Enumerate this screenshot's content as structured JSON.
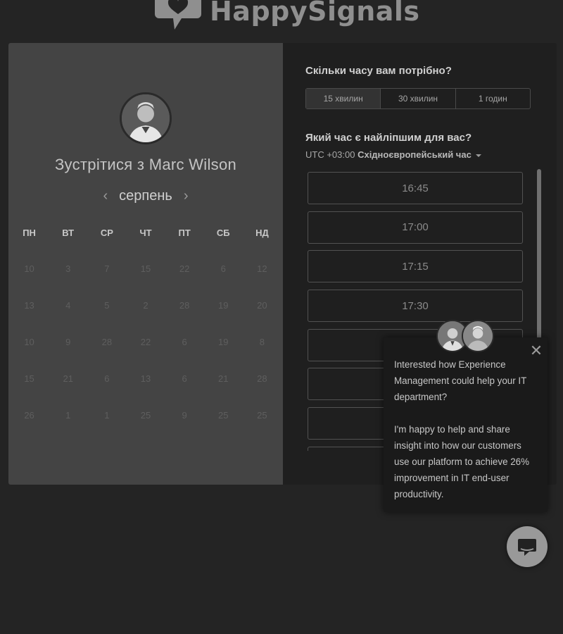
{
  "brand": {
    "logo_text": "HappySignals"
  },
  "calendar_panel": {
    "meet_title": "Зустрітися з Marc Wilson",
    "month": "серпень",
    "weekdays": [
      "ПН",
      "ВТ",
      "СР",
      "ЧТ",
      "ПТ",
      "СБ",
      "НД"
    ],
    "days": [
      "10",
      "3",
      "7",
      "15",
      "22",
      "6",
      "12",
      "13",
      "4",
      "5",
      "2",
      "28",
      "19",
      "20",
      "10",
      "9",
      "28",
      "22",
      "6",
      "19",
      "8",
      "15",
      "21",
      "6",
      "13",
      "6",
      "21",
      "28",
      "26",
      "1",
      "1",
      "25",
      "9",
      "25",
      "25"
    ]
  },
  "schedule_panel": {
    "duration_question": "Скільки часу вам потрібно?",
    "durations": [
      "15 хвилин",
      "30 хвилин",
      "1 годин"
    ],
    "selected_duration": "15 хвилин",
    "time_question": "Який час є найліпшим для вас?",
    "timezone_offset": "UTC +03:00",
    "timezone_name": "Східноєвропейський час",
    "time_slots": [
      "16:45",
      "17:00",
      "17:15",
      "17:30",
      "",
      "",
      "",
      ""
    ]
  },
  "chat_popup": {
    "paragraph1": "Interested how Experience Management could help your IT department?",
    "paragraph2": "I'm happy to help and share insight into how our customers use our platform to achieve 26% improvement in IT end-user productivity."
  },
  "icons": {
    "logo": "speech-bubble-heart-icon",
    "close": "close-icon",
    "chat": "chat-bubble-icon",
    "prev": "chevron-left-icon",
    "next": "chevron-right-icon"
  }
}
